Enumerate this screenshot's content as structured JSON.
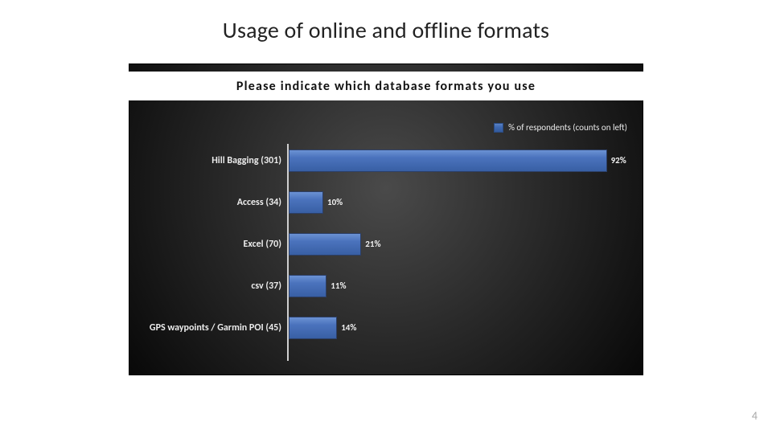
{
  "page_title": "Usage of online and offline formats",
  "page_number": "4",
  "chart_data": {
    "type": "bar",
    "title": "Please indicate which database formats you use",
    "legend": "% of respondents (counts on left)",
    "xlabel": "",
    "ylabel": "",
    "ylim": [
      0,
      100
    ],
    "categories": [
      "Hill Bagging (301)",
      "Access (34)",
      "Excel (70)",
      "csv (37)",
      "GPS waypoints / Garmin POI (45)"
    ],
    "values": [
      92,
      10,
      21,
      11,
      14
    ],
    "value_labels": [
      "92%",
      "10%",
      "21%",
      "11%",
      "14%"
    ]
  }
}
